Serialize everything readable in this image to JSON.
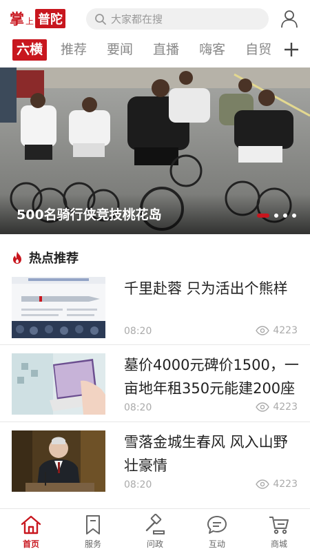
{
  "header": {
    "logo_part1": "掌",
    "logo_part2": "上",
    "logo_part3": "普陀",
    "search_placeholder": "大家都在搜",
    "search_icon": "search-icon",
    "user_icon": "user-icon"
  },
  "tabs": {
    "items": [
      "六横",
      "推荐",
      "要闻",
      "直播",
      "嗨客",
      "自贸"
    ],
    "active_index": 0,
    "add_icon": "plus-icon"
  },
  "banner": {
    "caption": "500名骑行侠竞技桃花岛",
    "slide_count": 4,
    "active_slide": 0
  },
  "hot_section": {
    "title": "热点推荐",
    "icon": "flame-icon"
  },
  "news": [
    {
      "title": "千里赴蓉 只为活出个熊样",
      "time": "08:20",
      "views": "4223"
    },
    {
      "title": "墓价4000元碑价1500，一亩地年租350元能建200座",
      "time": "08:20",
      "views": "4223"
    },
    {
      "title": "雪落金城生春风  风入山野壮豪情",
      "time": "08:20",
      "views": "4223"
    }
  ],
  "bottom_nav": [
    {
      "label": "首页",
      "icon": "home-icon"
    },
    {
      "label": "服务",
      "icon": "bookmark-icon"
    },
    {
      "label": "问政",
      "icon": "gavel-icon"
    },
    {
      "label": "互动",
      "icon": "chat-icon"
    },
    {
      "label": "商城",
      "icon": "cart-icon"
    }
  ],
  "colors": {
    "brand_red": "#c8161e",
    "text_dark": "#222222",
    "text_muted": "#aaaaaa"
  }
}
